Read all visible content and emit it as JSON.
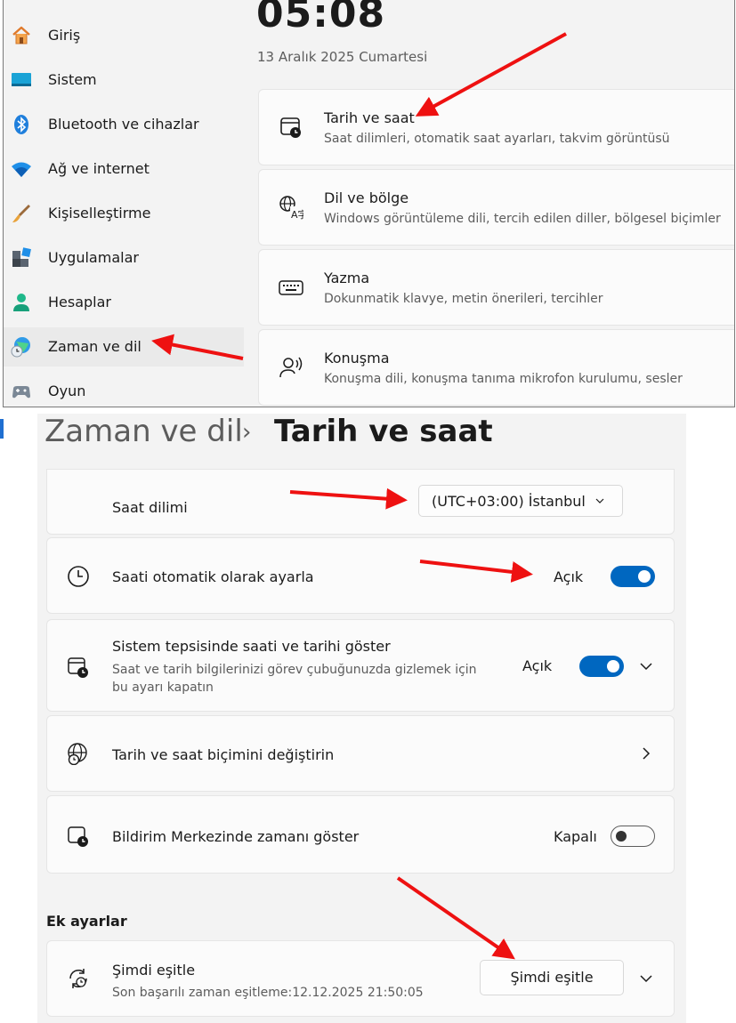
{
  "settings_home": {
    "nav_items": [
      {
        "label": "Giriş",
        "icon": "home-icon"
      },
      {
        "label": "Sistem",
        "icon": "system-icon"
      },
      {
        "label": "Bluetooth ve cihazlar",
        "icon": "bluetooth-icon"
      },
      {
        "label": "Ağ ve internet",
        "icon": "wifi-icon"
      },
      {
        "label": "Kişiselleştirme",
        "icon": "brush-icon"
      },
      {
        "label": "Uygulamalar",
        "icon": "apps-icon"
      },
      {
        "label": "Hesaplar",
        "icon": "person-icon"
      },
      {
        "label": "Zaman ve dil",
        "icon": "globe-clock-icon",
        "selected": true
      },
      {
        "label": "Oyun",
        "icon": "gamepad-icon"
      }
    ],
    "clock": "05:08",
    "date": "13 Aralık 2025 Cumartesi",
    "cards": [
      {
        "title": "Tarih ve saat",
        "desc": "Saat dilimleri, otomatik saat ayarları, takvim görüntüsü",
        "icon": "calendar-clock-icon"
      },
      {
        "title": "Dil ve bölge",
        "desc": "Windows görüntüleme dili, tercih edilen diller, bölgesel biçimler",
        "icon": "language-icon"
      },
      {
        "title": "Yazma",
        "desc": "Dokunmatik klavye, metin önerileri, tercihler",
        "icon": "keyboard-icon"
      },
      {
        "title": "Konuşma",
        "desc": "Konuşma dili, konuşma tanıma mikrofon kurulumu, sesler",
        "icon": "speech-icon"
      }
    ]
  },
  "date_time_page": {
    "breadcrumb_parent": "Zaman ve dil",
    "breadcrumb_separator": "›",
    "breadcrumb_current": "Tarih ve saat",
    "timezone": {
      "label": "Saat dilimi",
      "value": "(UTC+03:00) İstanbul"
    },
    "auto_time": {
      "label": "Saati otomatik olarak ayarla",
      "state": "Açık",
      "on": true
    },
    "tray": {
      "label": "Sistem tepsisinde saati ve tarihi göster",
      "desc": "Saat ve tarih bilgilerinizi görev çubuğunuzda gizlemek için bu ayarı kapatın",
      "state": "Açık",
      "on": true
    },
    "format": {
      "label": "Tarih ve saat biçimini değiştirin"
    },
    "notif": {
      "label": "Bildirim Merkezinde zamanı göster",
      "state": "Kapalı",
      "on": false
    },
    "section_title": "Ek ayarlar",
    "sync": {
      "label": "Şimdi eşitle",
      "desc": "Son başarılı zaman eşitleme:12.12.2025 21:50:05",
      "button": "Şimdi eşitle"
    }
  },
  "colors": {
    "accent": "#0067c0",
    "annotation_arrow": "#ee1111",
    "background": "#f3f3f3"
  }
}
